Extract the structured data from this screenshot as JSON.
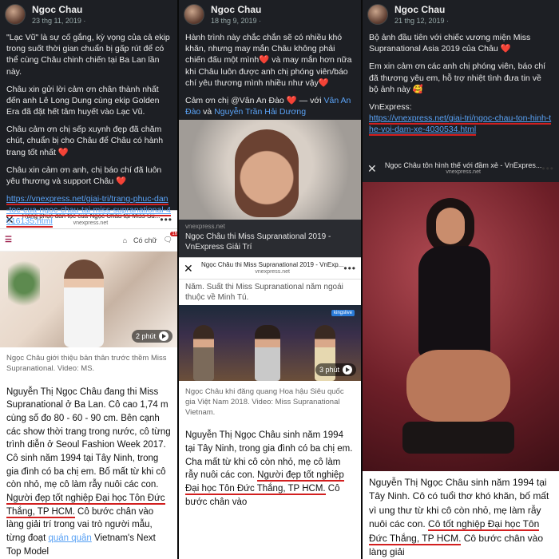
{
  "col1": {
    "post": {
      "author": "Ngoc Chau",
      "date": "23 thg 11, 2019 ·",
      "paragraphs": [
        "\"Lạc Vũ\" là sự cố gắng, kỳ vọng của cả ekip trong suốt thời gian chuẩn bị gấp rút để có thể cùng Châu chinh chiến tại Ba Lan lần này.",
        "Châu xin gửi lời cảm ơn chân thành nhất đến anh Lê Long Dung cùng ekip Golden Era đã đặt hết tâm huyết vào Lạc Vũ.",
        "Châu cảm ơn chị sếp xuynh đẹp đã chăm chút, chuẩn bị cho Châu để Châu có hành trang tốt nhất ❤️",
        "Châu xin cảm ơn anh, chị báo chí đã luôn yêu thương và support Châu ❤️"
      ],
      "link": "https://vnexpress.net/giai-tri/trang-phuc-dan-toc-cua-ngoc-chau-tai-miss-supranational-4016135.html"
    },
    "bar": {
      "title": "Trang phục dân tộc của Ngọc Châu tại Miss Su...",
      "domain": "vnexpress.net"
    },
    "article": {
      "topbar_text": "Có chữ",
      "notif_count": "16",
      "duration": "2 phút",
      "caption": "Ngọc Châu giới thiệu bản thân trước thềm Miss Supranational. Video: MS.",
      "text_before": "Nguyễn Thị Ngọc Châu đang thi Miss Supranational ở Ba Lan. Cô cao 1,74 m cùng số đo 80 - 60 - 90 cm. Bên cạnh các show thời trang trong nước, cô từng trình diễn ở Seoul Fashion Week 2017. Cô sinh năm 1994 tại Tây Ninh, trong gia đình có ba chị em. Bố mất từ khi cô còn nhỏ, mẹ cô làm rẫy nuôi các con.",
      "underlined": "Người đẹp tốt nghiệp Đại học Tôn Đức Thắng, TP HCM.",
      "text_after": " Cô bước chân vào làng giải trí trong vai trò người mẫu, từng đoạt ",
      "link_word": "quán quân",
      "text_end": " Vietnam's Next Top Model"
    }
  },
  "col2": {
    "post": {
      "author": "Ngoc Chau",
      "date": "18 thg 9, 2019 ·",
      "paragraph1": "Hành trình này chắc chắn sẽ có nhiều khó khăn, nhưng may mắn Châu không phải chiến đấu một mình❤️ và may mắn hơn nữa khi Châu luôn được anh chị phóng viên/báo chí yêu thương mình nhiều như vậy❤️",
      "thanks_prefix": "Cảm ơn chị @Vân An Đào ❤️ — với ",
      "mention1": "Vân An Đào",
      "thanks_mid": " và ",
      "mention2": "Nguyễn Trần Hải Dương"
    },
    "linkbox": {
      "domain": "vnexpress.net",
      "title": "Ngọc Châu thi Miss Supranational 2019 - VnExpress Giải Trí"
    },
    "bar": {
      "title": "Ngọc Châu thi Miss Supranational 2019 - VnExp...",
      "domain": "vnexpress.net"
    },
    "article": {
      "snippet": "Năm. Suất thi Miss Supranational năm ngoái thuộc về Minh Tú.",
      "live_badge": "kingslive",
      "duration": "3 phút",
      "caption": "Ngọc Châu khi đăng quang Hoa hậu Siêu quốc gia Việt Nam 2018. Video: Miss Supranational Vietnam.",
      "text_before": "Nguyễn Thị Ngọc Châu sinh năm 1994 tại Tây Ninh, trong gia đình có ba chị em. Cha mất từ khi cô còn nhỏ, mẹ cô làm rẫy nuôi các con. ",
      "underlined": "Người đẹp tốt nghiệp Đại học Tôn Đức Thắng, TP HCM.",
      "text_after": " Cô bước chân vào"
    }
  },
  "col3": {
    "post": {
      "author": "Ngoc Chau",
      "date": "21 thg 12, 2019 ·",
      "paragraph1": "Bộ ảnh đầu tiên với chiếc vương miện Miss Supranational Asia 2019 của Châu ❤️",
      "paragraph2": "Em xin cảm ơn các anh chị phóng viên, báo chí đã thương yêu em, hỗ trợ nhiệt tình đưa tin về bộ ảnh này 🥰",
      "label": "VnExpress:",
      "link": "https://vnexpress.net/giai-tri/ngoc-chau-ton-hinh-the-voi-dam-xe-4030534.html"
    },
    "bar": {
      "title": "Ngọc Châu tôn hình thể với đầm xẻ - VnExpres...",
      "domain": "vnexpress.net"
    },
    "article": {
      "text_before": "Nguyễn Thị Ngọc Châu sinh năm 1994 tại Tây Ninh. Cô có tuổi thơ khó khăn, bố mất vì ung thư từ khi cô còn nhỏ, mẹ làm rẫy nuôi các con. ",
      "underlined": "Cô tốt nghiệp Đại học Tôn Đức Thắng, TP HCM.",
      "text_after": " Cô bước chân vào làng giải"
    }
  },
  "icons": {
    "close": "✕",
    "more": "•••"
  }
}
